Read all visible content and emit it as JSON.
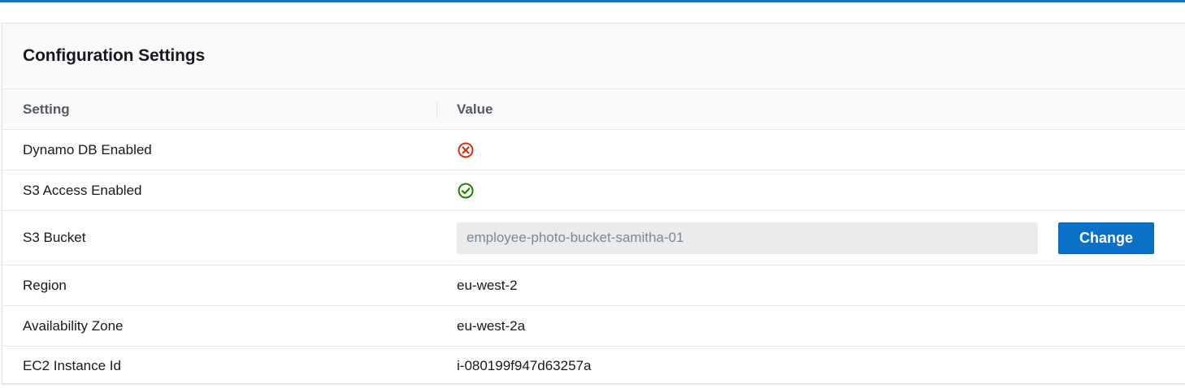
{
  "panel": {
    "title": "Configuration Settings"
  },
  "table": {
    "headers": {
      "setting": "Setting",
      "value": "Value"
    },
    "rows": [
      {
        "setting": "Dynamo DB Enabled",
        "status": "disabled",
        "icon": "x-circle-icon",
        "color": "#d13212"
      },
      {
        "setting": "S3 Access Enabled",
        "status": "enabled",
        "icon": "check-circle-icon",
        "color": "#1d8102"
      },
      {
        "setting": "S3 Bucket",
        "input_value": "employee-photo-bucket-samitha-01",
        "button_label": "Change"
      },
      {
        "setting": "Region",
        "value": "eu-west-2"
      },
      {
        "setting": "Availability Zone",
        "value": "eu-west-2a"
      },
      {
        "setting": "EC2 Instance Id",
        "value": "i-080199f947d63257a"
      }
    ]
  },
  "colors": {
    "accent": "#1f73b7",
    "button": "#0972c8",
    "error": "#d13212",
    "success": "#1d8102"
  }
}
